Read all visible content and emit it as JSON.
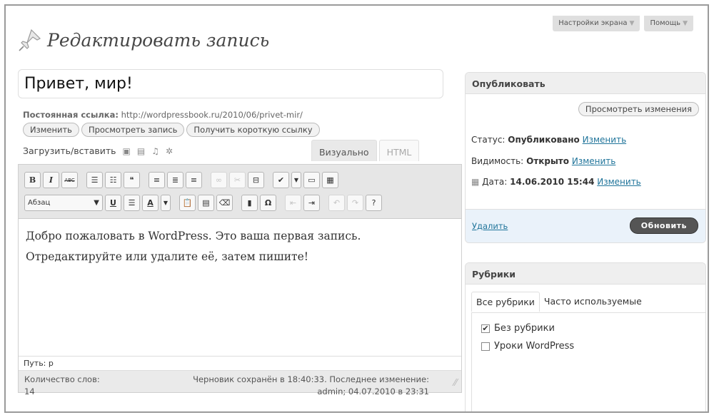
{
  "header": {
    "page_title": "Редактировать запись",
    "screen_options": "Настройки экрана",
    "help": "Помощь"
  },
  "post": {
    "title_value": "Привет, мир!",
    "permalink_label": "Постоянная ссылка:",
    "permalink_url": "http://wordpressbook.ru/2010/06/privet-mir/",
    "edit_button": "Изменить",
    "view_button": "Просмотреть запись",
    "shortlink_button": "Получить короткую ссылку"
  },
  "editor": {
    "upload_label": "Загрузить/вставить",
    "tab_visual": "Визуально",
    "tab_html": "HTML",
    "format_select": "Абзац",
    "content_lines": [
      "Добро пожаловать в WordPress. Это ваша первая запись.",
      "Отредактируйте или удалите её, затем пишите!"
    ],
    "path": "Путь: p",
    "word_count_label": "Количество слов:",
    "word_count": "14",
    "draft_line1": "Черновик сохранён в 18:40:33. Последнее изменение:",
    "draft_line2": "admin; 04.07.2010 в 23:31"
  },
  "publish": {
    "title": "Опубликовать",
    "preview_button": "Просмотреть изменения",
    "status_label": "Статус:",
    "status_value": "Опубликовано",
    "visibility_label": "Видимость:",
    "visibility_value": "Открыто",
    "date_label": "Дата:",
    "date_value": "14.06.2010 15:44",
    "edit_link": "Изменить",
    "delete_link": "Удалить",
    "update_button": "Обновить"
  },
  "categories": {
    "title": "Рубрики",
    "tab_all": "Все рубрики",
    "tab_popular": "Часто используемые",
    "items": [
      {
        "label": "Без рубрики",
        "checked": true
      },
      {
        "label": "Уроки WordPress",
        "checked": false
      }
    ]
  }
}
